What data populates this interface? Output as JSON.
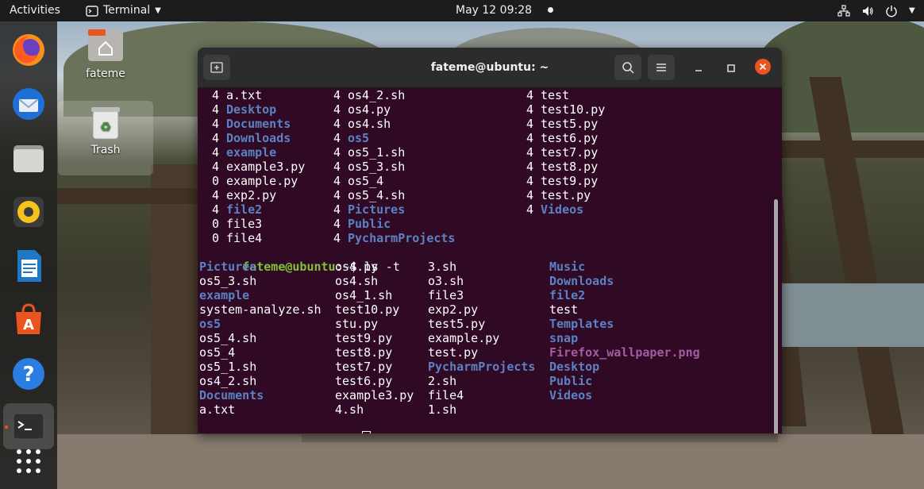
{
  "topbar": {
    "activities": "Activities",
    "app_menu": "Terminal",
    "datetime": "May 12  09:28"
  },
  "desktop": {
    "home_label": "fateme",
    "trash_label": "Trash"
  },
  "dock": {
    "items": [
      "firefox-icon",
      "thunderbird-icon",
      "files-icon",
      "rhythmbox-icon",
      "writer-icon",
      "software-icon",
      "help-icon",
      "terminal-icon",
      "app-grid-icon"
    ]
  },
  "terminal": {
    "title": "fateme@ubuntu: ~",
    "prompt_user": "fateme@ubuntu",
    "prompt_sep": ":",
    "prompt_path": "~",
    "prompt_dollar": "$",
    "command": "ls -t",
    "ls_s_columns": [
      [
        {
          "size": "4",
          "name": "a.txt",
          "type": "file"
        },
        {
          "size": "4",
          "name": "Desktop",
          "type": "dir"
        },
        {
          "size": "4",
          "name": "Documents",
          "type": "dir"
        },
        {
          "size": "4",
          "name": "Downloads",
          "type": "dir"
        },
        {
          "size": "4",
          "name": "example",
          "type": "dir"
        },
        {
          "size": "4",
          "name": "example3.py",
          "type": "file"
        },
        {
          "size": "0",
          "name": "example.py",
          "type": "file"
        },
        {
          "size": "4",
          "name": "exp2.py",
          "type": "file"
        },
        {
          "size": "4",
          "name": "file2",
          "type": "dir"
        },
        {
          "size": "0",
          "name": "file3",
          "type": "file"
        },
        {
          "size": "0",
          "name": "file4",
          "type": "file"
        }
      ],
      [
        {
          "size": "4",
          "name": "os4_2.sh",
          "type": "file"
        },
        {
          "size": "4",
          "name": "os4.py",
          "type": "file"
        },
        {
          "size": "4",
          "name": "os4.sh",
          "type": "file"
        },
        {
          "size": "4",
          "name": "os5",
          "type": "dir"
        },
        {
          "size": "4",
          "name": "os5_1.sh",
          "type": "file"
        },
        {
          "size": "4",
          "name": "os5_3.sh",
          "type": "file"
        },
        {
          "size": "4",
          "name": "os5_4",
          "type": "file"
        },
        {
          "size": "4",
          "name": "os5_4.sh",
          "type": "file"
        },
        {
          "size": "4",
          "name": "Pictures",
          "type": "dir"
        },
        {
          "size": "4",
          "name": "Public",
          "type": "dir"
        },
        {
          "size": "4",
          "name": "PycharmProjects",
          "type": "dir"
        }
      ],
      [
        {
          "size": "4",
          "name": "test",
          "type": "file"
        },
        {
          "size": "4",
          "name": "test10.py",
          "type": "file"
        },
        {
          "size": "4",
          "name": "test5.py",
          "type": "file"
        },
        {
          "size": "4",
          "name": "test6.py",
          "type": "file"
        },
        {
          "size": "4",
          "name": "test7.py",
          "type": "file"
        },
        {
          "size": "4",
          "name": "test8.py",
          "type": "file"
        },
        {
          "size": "4",
          "name": "test9.py",
          "type": "file"
        },
        {
          "size": "4",
          "name": "test.py",
          "type": "file"
        },
        {
          "size": "4",
          "name": "Videos",
          "type": "dir"
        }
      ]
    ],
    "ls_t_columns": [
      [
        {
          "name": "Pictures",
          "type": "dir"
        },
        {
          "name": "os5_3.sh",
          "type": "file"
        },
        {
          "name": "example",
          "type": "dir"
        },
        {
          "name": "system-analyze.sh",
          "type": "file"
        },
        {
          "name": "os5",
          "type": "dir"
        },
        {
          "name": "os5_4.sh",
          "type": "file"
        },
        {
          "name": "os5_4",
          "type": "file"
        },
        {
          "name": "os5_1.sh",
          "type": "file"
        },
        {
          "name": "os4_2.sh",
          "type": "file"
        },
        {
          "name": "Documents",
          "type": "dir"
        },
        {
          "name": "a.txt",
          "type": "file"
        }
      ],
      [
        {
          "name": "os4.py",
          "type": "file"
        },
        {
          "name": "os4.sh",
          "type": "file"
        },
        {
          "name": "os4_1.sh",
          "type": "file"
        },
        {
          "name": "test10.py",
          "type": "file"
        },
        {
          "name": "stu.py",
          "type": "file"
        },
        {
          "name": "test9.py",
          "type": "file"
        },
        {
          "name": "test8.py",
          "type": "file"
        },
        {
          "name": "test7.py",
          "type": "file"
        },
        {
          "name": "test6.py",
          "type": "file"
        },
        {
          "name": "example3.py",
          "type": "file"
        },
        {
          "name": "4.sh",
          "type": "file"
        }
      ],
      [
        {
          "name": "3.sh",
          "type": "file"
        },
        {
          "name": "o3.sh",
          "type": "file"
        },
        {
          "name": "file3",
          "type": "file"
        },
        {
          "name": "exp2.py",
          "type": "file"
        },
        {
          "name": "test5.py",
          "type": "file"
        },
        {
          "name": "example.py",
          "type": "file"
        },
        {
          "name": "test.py",
          "type": "file"
        },
        {
          "name": "PycharmProjects",
          "type": "dir"
        },
        {
          "name": "2.sh",
          "type": "file"
        },
        {
          "name": "file4",
          "type": "file"
        },
        {
          "name": "1.sh",
          "type": "file"
        }
      ],
      [
        {
          "name": "Music",
          "type": "dir"
        },
        {
          "name": "Downloads",
          "type": "dir"
        },
        {
          "name": "file2",
          "type": "dir"
        },
        {
          "name": "test",
          "type": "file"
        },
        {
          "name": "Templates",
          "type": "dir"
        },
        {
          "name": "snap",
          "type": "dir"
        },
        {
          "name": "Firefox_wallpaper.png",
          "type": "png"
        },
        {
          "name": "Desktop",
          "type": "dir"
        },
        {
          "name": "Public",
          "type": "dir"
        },
        {
          "name": "Videos",
          "type": "dir"
        }
      ]
    ]
  },
  "colors": {
    "terminal_bg": "#300a24",
    "dir": "#5c82c4",
    "prompt_user": "#7fc235",
    "image_file": "#a35ca0",
    "close_button": "#e95420"
  }
}
